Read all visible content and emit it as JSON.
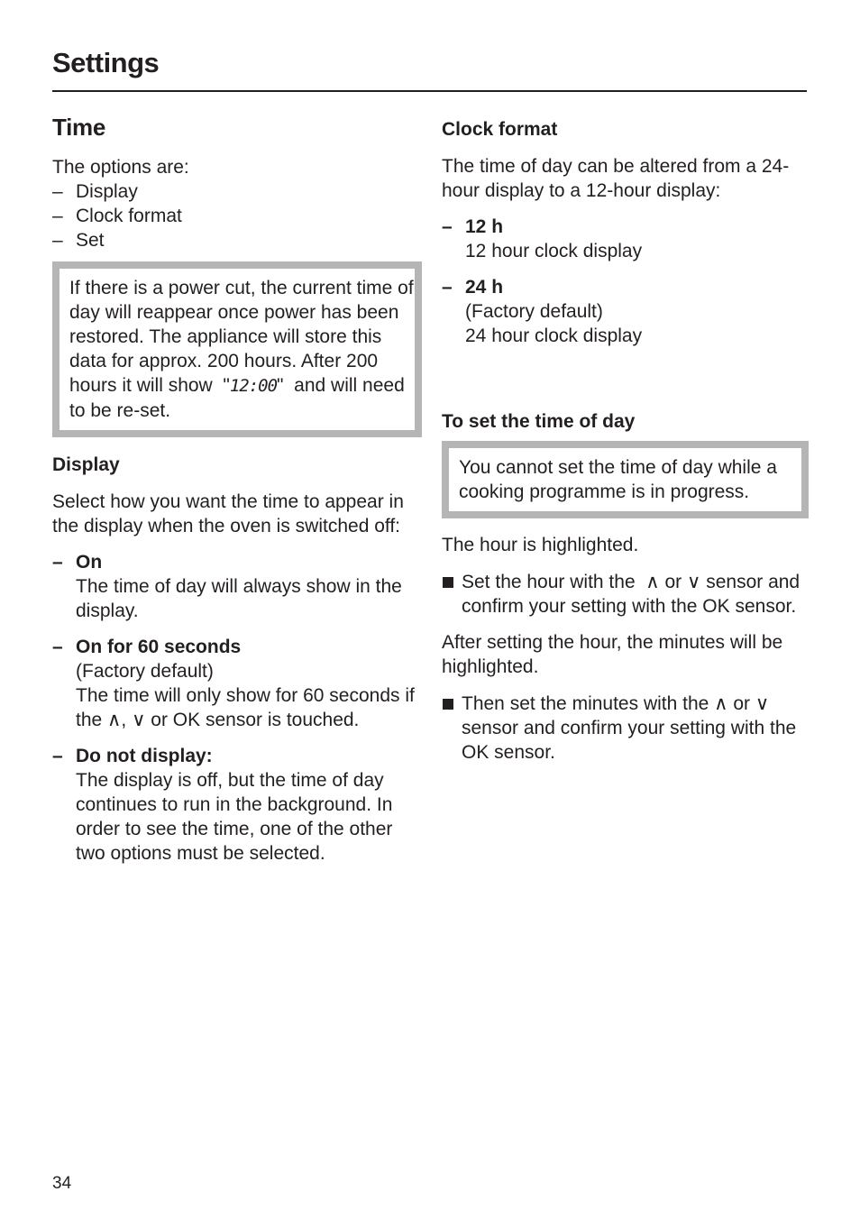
{
  "header": {
    "title": "Settings"
  },
  "left": {
    "heading": "Time",
    "intro": "The options are:",
    "options": [
      "Display",
      "Clock format",
      "Set"
    ],
    "dash": "–",
    "note": {
      "part1": "If there is a power cut, the current time of day will reappear once power has been restored. The appliance will store this data for approx. 200 hours. After 200 hours it will show  \"",
      "display_value": "12:00",
      "part2": "\"  and will need to be re-set."
    },
    "display": {
      "heading": "Display",
      "intro": "Select how you want the time to appear in the display when the oven is switched off:",
      "items": [
        {
          "label": "On",
          "lines": [
            "The time of day will always show in the display."
          ]
        },
        {
          "label": "On for 60 seconds",
          "lines": [
            "(Factory default)",
            "The time will only show for 60 seconds if the ∧, ∨ or OK sensor is touched."
          ]
        },
        {
          "label": "Do not display:",
          "lines": [
            "The display is off, but the time of day continues to run in the background. In order to see the time, one of the other two options must be selected."
          ]
        }
      ]
    }
  },
  "right": {
    "clock_format": {
      "heading": "Clock format",
      "intro": "The time of day can be altered from a 24-hour display to a 12-hour display:",
      "items": [
        {
          "label": "12 h",
          "lines": [
            "12 hour clock display"
          ]
        },
        {
          "label": "24 h",
          "lines": [
            "(Factory default)",
            "24 hour clock display"
          ]
        }
      ]
    },
    "set_time": {
      "heading": "To set the time of day",
      "note": "You cannot set the time of day while a cooking programme is in progress.",
      "hour_text": "The hour is highlighted.",
      "step1": "Set the hour with the  ∧ or ∨ sensor and confirm your setting with the OK sensor.",
      "after_text": "After setting the hour, the minutes will be highlighted.",
      "step2": "Then set the minutes with the ∧ or ∨ sensor and confirm your setting with the OK sensor."
    }
  },
  "footer": {
    "page_number": "34"
  }
}
